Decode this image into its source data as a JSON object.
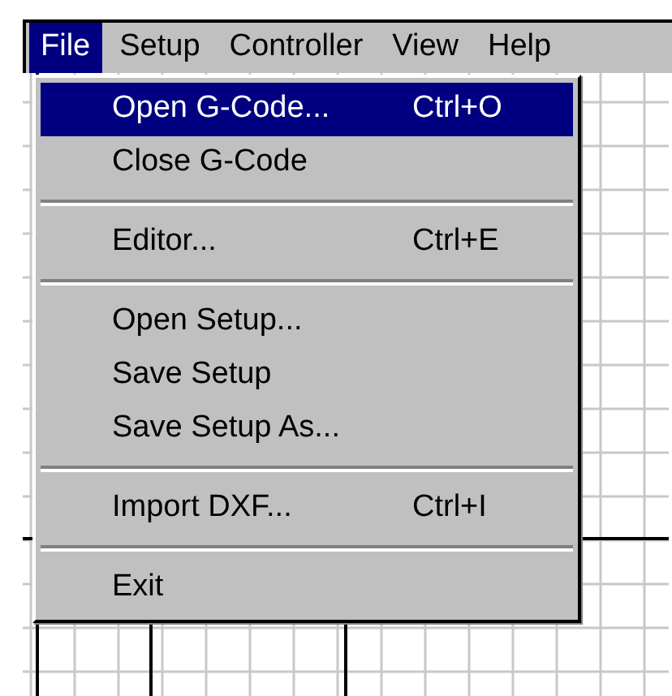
{
  "menubar": [
    {
      "label": "File",
      "selected": true
    },
    {
      "label": "Setup",
      "selected": false
    },
    {
      "label": "Controller",
      "selected": false
    },
    {
      "label": "View",
      "selected": false
    },
    {
      "label": "Help",
      "selected": false
    }
  ],
  "file_menu": [
    {
      "kind": "item",
      "label": "Open G-Code...",
      "shortcut": "Ctrl+O",
      "selected": true
    },
    {
      "kind": "item",
      "label": "Close G-Code",
      "selected": false
    },
    {
      "kind": "separator"
    },
    {
      "kind": "item",
      "label": "Editor...",
      "shortcut": "Ctrl+E",
      "selected": false
    },
    {
      "kind": "separator"
    },
    {
      "kind": "item",
      "label": "Open Setup...",
      "selected": false
    },
    {
      "kind": "item",
      "label": "Save Setup",
      "selected": false
    },
    {
      "kind": "item",
      "label": "Save Setup As...",
      "selected": false
    },
    {
      "kind": "separator"
    },
    {
      "kind": "item",
      "label": "Import DXF...",
      "shortcut": "Ctrl+I",
      "selected": false
    },
    {
      "kind": "separator"
    },
    {
      "kind": "item",
      "label": "Exit",
      "selected": false
    }
  ]
}
